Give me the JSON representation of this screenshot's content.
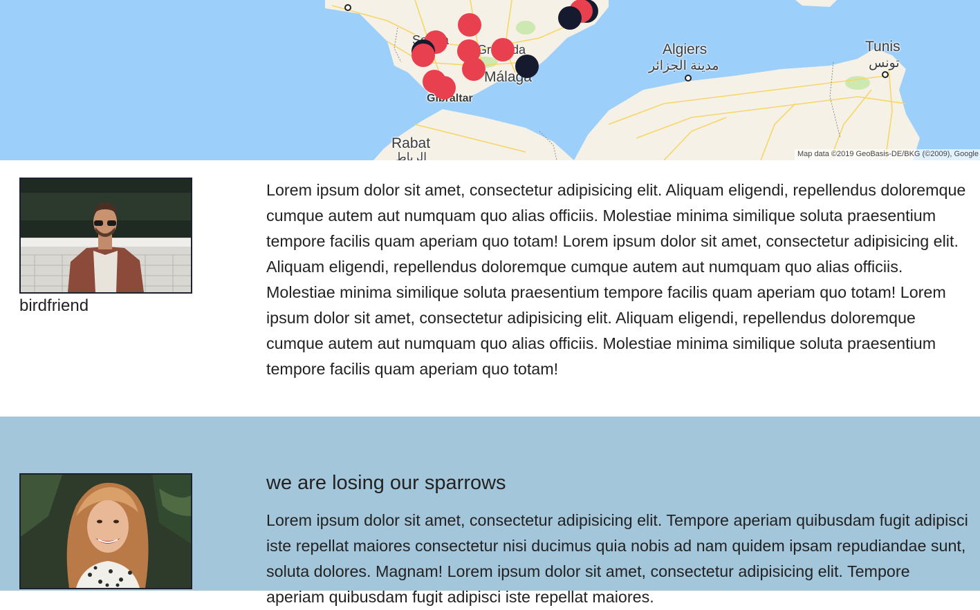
{
  "map": {
    "labels": {
      "algiers": "Algiers",
      "algiers_ar": "مدينة الجزائر",
      "tunis": "Tunis",
      "tunis_ar": "تونس",
      "malaga": "Málaga",
      "granada": "Granada",
      "sevilla": "Sevilla",
      "gibraltar": "Gibraltar",
      "rabat": "Rabat",
      "rabat_ar": "الرباط"
    },
    "attribution": "Map data ©2019 GeoBasis-DE/BKG (©2009), Google",
    "colors": {
      "water": "#9ccffa",
      "land": "#f5f1e6",
      "marker_red": "#e8404f",
      "marker_dark": "#151a2e"
    }
  },
  "posts": [
    {
      "username": "birdfriend",
      "title": "",
      "body": "Lorem ipsum dolor sit amet, consectetur adipisicing elit. Aliquam eligendi, repellendus doloremque cumque autem aut numquam quo alias officiis. Molestiae minima similique soluta praesentium tempore facilis quam aperiam quo totam! Lorem ipsum dolor sit amet, consectetur adipisicing elit. Aliquam eligendi, repellendus doloremque cumque autem aut numquam quo alias officiis. Molestiae minima similique soluta praesentium tempore facilis quam aperiam quo totam! Lorem ipsum dolor sit amet, consectetur adipisicing elit. Aliquam eligendi, repellendus doloremque cumque autem aut numquam quo alias officiis. Molestiae minima similique soluta praesentium tempore facilis quam aperiam quo totam!"
    },
    {
      "username": "",
      "title": "we are losing our sparrows",
      "body": "Lorem ipsum dolor sit amet, consectetur adipisicing elit. Tempore aperiam quibusdam fugit adipisci iste repellat maiores consectetur nisi ducimus quia nobis ad nam quidem ipsam repudiandae sunt, soluta dolores. Magnam! Lorem ipsum dolor sit amet, consectetur adipisicing elit. Tempore aperiam quibusdam fugit adipisci iste repellat maiores."
    }
  ]
}
